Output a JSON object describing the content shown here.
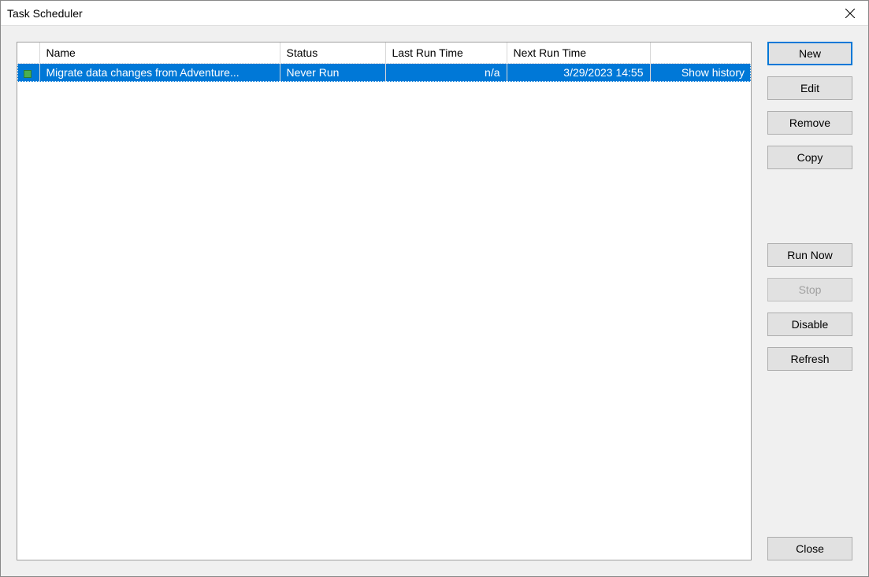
{
  "window": {
    "title": "Task Scheduler"
  },
  "table": {
    "columns": {
      "icon": "",
      "name": "Name",
      "status": "Status",
      "last_run": "Last Run Time",
      "next_run": "Next Run Time",
      "action": ""
    },
    "rows": [
      {
        "name": "Migrate data changes from Adventure...",
        "status": "Never Run",
        "last_run": "n/a",
        "next_run": "3/29/2023 14:55",
        "action": "Show history",
        "selected": true
      }
    ]
  },
  "buttons": {
    "new": "New",
    "edit": "Edit",
    "remove": "Remove",
    "copy": "Copy",
    "run_now": "Run Now",
    "stop": "Stop",
    "disable": "Disable",
    "refresh": "Refresh",
    "close": "Close"
  }
}
